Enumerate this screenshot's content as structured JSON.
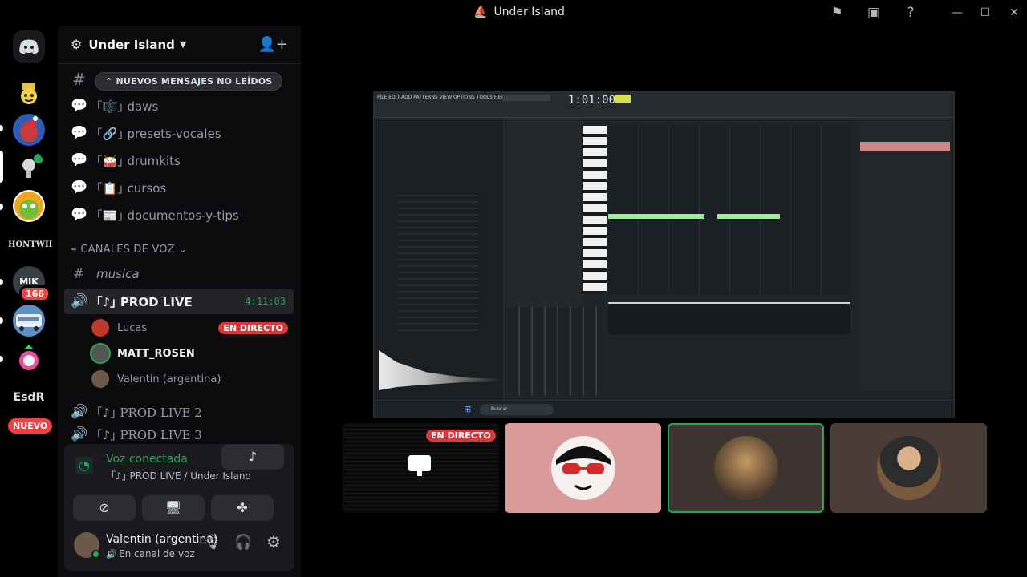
{
  "window": {
    "title": "Under Island",
    "controls": [
      "minimize",
      "maximize",
      "close"
    ]
  },
  "rail": {
    "servers": [
      {
        "icon": "discord-home-icon"
      },
      {
        "icon": "server-minecraft-icon"
      },
      {
        "icon": "server-christmas-icon"
      },
      {
        "icon": "server-microphone-icon"
      },
      {
        "icon": "server-cartoon-icon"
      },
      {
        "text": "HONTWII"
      },
      {
        "text": "MIK",
        "badge": "166"
      },
      {
        "icon": "server-bus-icon"
      },
      {
        "icon": "server-anime-icon"
      },
      {
        "text": "EsdR"
      },
      {
        "text": "NUEVO"
      }
    ]
  },
  "sidebar": {
    "guild_name": "Under Island",
    "new_messages": "NUEVOS MENSAJES NO LEÍDOS",
    "text_channels": [
      {
        "icon": "🎼",
        "name": "daws"
      },
      {
        "icon": "🔗",
        "name": "presets-vocales"
      },
      {
        "icon": "🥁",
        "name": "drumkits"
      },
      {
        "icon": "📋",
        "name": "cursos"
      },
      {
        "icon": "📰",
        "name": "documentos-y-tips"
      }
    ],
    "voice_category": "CANALES DE VOZ",
    "musica_channel": "musica",
    "active_voice": {
      "name": "PROD LIVE",
      "bracket": "｢♪｣",
      "timer": "4:11:03"
    },
    "voice_users": [
      {
        "name": "Lucas",
        "live": "EN DIRECTO"
      },
      {
        "name": "MATT_ROSEN",
        "live": ""
      },
      {
        "name": "Valentin (argentina)",
        "live": ""
      }
    ],
    "other_voice": [
      {
        "bracket": "｢♪｣",
        "name": "PROD LIVE 2"
      },
      {
        "bracket": "｢♪｣",
        "name": "PROD LIVE 3"
      }
    ]
  },
  "voice_panel": {
    "status": "Voz conectada",
    "channel": "｢♪｣ PROD LIVE / Under Island",
    "user_name": "Valentin (argentina)",
    "user_status": "En canal de voz"
  },
  "stage": {
    "live_label": "EN DIRECTO",
    "tiles": [
      {
        "kind": "screen"
      },
      {
        "kind": "avatar",
        "bg": "#d99b99"
      },
      {
        "kind": "avatar",
        "bg": "#3d3431",
        "speaking": true
      },
      {
        "kind": "avatar",
        "bg": "#4a3d37"
      }
    ],
    "stream_menu": "FILE EDIT ADD PATTERNS VIEW OPTIONS TOOLS HELP",
    "stream_time": "1:01:00",
    "stream_search": "Buscar"
  },
  "colors": {
    "green": "#23a55a",
    "red": "#da373c",
    "blurple": "#5865f2"
  }
}
